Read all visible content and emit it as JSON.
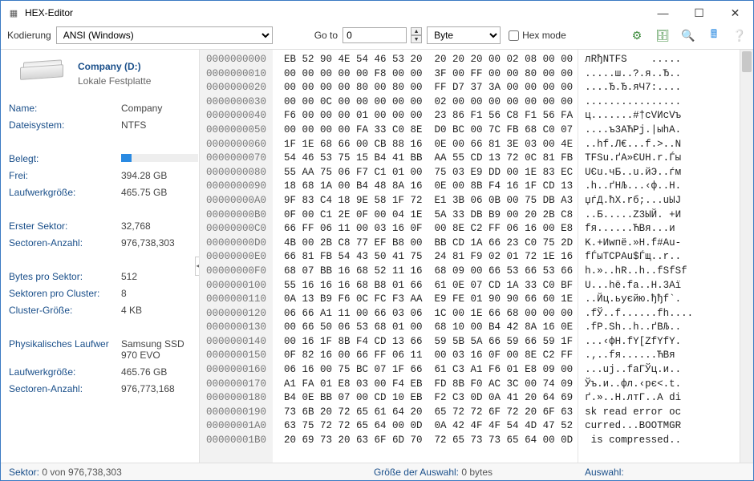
{
  "window": {
    "title": "HEX-Editor"
  },
  "toolbar": {
    "encoding_label": "Kodierung",
    "encoding_value": "ANSI (Windows)",
    "goto_label": "Go to",
    "goto_value": "0",
    "unit_value": "Byte",
    "hexmode_label": "Hex mode",
    "icons": [
      "gear-icon",
      "db-plus-icon",
      "search-icon",
      "calc-icon",
      "help-icon"
    ]
  },
  "drive": {
    "title": "Company (D:)",
    "subtitle": "Lokale Festplatte"
  },
  "props": [
    {
      "label": "Name:",
      "value": "Company"
    },
    {
      "label": "Dateisystem:",
      "value": "NTFS"
    },
    {
      "sep": true
    },
    {
      "label": "Belegt:",
      "value": "",
      "bar": 14
    },
    {
      "label": "Frei:",
      "value": "394.28 GB"
    },
    {
      "label": "Laufwerkgröße:",
      "value": "465.75 GB"
    },
    {
      "sep": true
    },
    {
      "label": "Erster Sektor:",
      "value": "32,768"
    },
    {
      "label": "Sectoren-Anzahl:",
      "value": "976,738,303"
    },
    {
      "sep": true
    },
    {
      "label": "Bytes pro Sektor:",
      "value": "512"
    },
    {
      "label": "Sektoren pro Cluster:",
      "value": "8"
    },
    {
      "label": "Cluster-Größe:",
      "value": "4 KB"
    },
    {
      "sep": true
    },
    {
      "label": "Physikalisches Laufwer",
      "value": "Samsung SSD 970 EVO"
    },
    {
      "label": "Laufwerkgröße:",
      "value": "465.76 GB"
    },
    {
      "label": "Sectoren-Anzahl:",
      "value": "976,773,168"
    }
  ],
  "hex": {
    "offsets": "0000000000\n0000000010\n0000000020\n0000000030\n0000000040\n0000000050\n0000000060\n0000000070\n0000000080\n0000000090\n00000000A0\n00000000B0\n00000000C0\n00000000D0\n00000000E0\n00000000F0\n0000000100\n0000000110\n0000000120\n0000000130\n0000000140\n0000000150\n0000000160\n0000000170\n0000000180\n0000000190\n00000001A0\n00000001B0",
    "bytes": "EB 52 90 4E 54 46 53 20  20 20 20 00 02 08 00 00\n00 00 00 00 00 F8 00 00  3F 00 FF 00 00 80 00 00\n00 00 00 00 80 00 80 00  FF D7 37 3A 00 00 00 00\n00 00 0C 00 00 00 00 00  02 00 00 00 00 00 00 00\nF6 00 00 00 01 00 00 00  23 86 F1 56 C8 F1 56 FA\n00 00 00 00 FA 33 C0 8E  D0 BC 00 7C FB 68 C0 07\n1F 1E 68 66 00 CB 88 16  0E 00 66 81 3E 03 00 4E\n54 46 53 75 15 B4 41 BB  AA 55 CD 13 72 0C 81 FB\n55 AA 75 06 F7 C1 01 00  75 03 E9 DD 00 1E 83 EC\n18 68 1A 00 B4 48 8A 16  0E 00 8B F4 16 1F CD 13\n9F 83 C4 18 9E 58 1F 72  E1 3B 06 0B 00 75 DB A3\n0F 00 C1 2E 0F 00 04 1E  5A 33 DB B9 00 20 2B C8\n66 FF 06 11 00 03 16 0F  00 8E C2 FF 06 16 00 E8\n4B 00 2B C8 77 EF B8 00  BB CD 1A 66 23 C0 75 2D\n66 81 FB 54 43 50 41 75  24 81 F9 02 01 72 1E 16\n68 07 BB 16 68 52 11 16  68 09 00 66 53 66 53 66\n55 16 16 16 68 B8 01 66  61 0E 07 CD 1A 33 C0 BF\n0A 13 B9 F6 0C FC F3 AA  E9 FE 01 90 90 66 60 1E\n06 66 A1 11 00 66 03 06  1C 00 1E 66 68 00 00 00\n00 66 50 06 53 68 01 00  68 10 00 B4 42 8A 16 0E\n00 16 1F 8B F4 CD 13 66  59 5B 5A 66 59 66 59 1F\n0F 82 16 00 66 FF 06 11  00 03 16 0F 00 8E C2 FF\n06 16 00 75 BC 07 1F 66  61 C3 A1 F6 01 E8 09 00\nA1 FA 01 E8 03 00 F4 EB  FD 8B F0 AC 3C 00 74 09\nB4 0E BB 07 00 CD 10 EB  F2 C3 0D 0A 41 20 64 69\n73 6B 20 72 65 61 64 20  65 72 72 6F 72 20 6F 63\n63 75 72 72 65 64 00 0D  0A 42 4F 4F 54 4D 47 52\n20 69 73 20 63 6F 6D 70  72 65 73 73 65 64 00 0D",
    "ascii": "лRђNTFS    .....\n.....ш..?.я..Ђ..\n....Ђ.Ђ.яЧ7:....\n................\nц.......#†сVИсVъ\n....ъ3АЋРј.|ыhА.\n..hf.Л€...f.>..N\nTFSu.ґA»ЄUН.r.Ѓы\nUЄu.чБ..u.йЭ..ѓм\n.h..ґHЉ...‹ф..Н.\nџѓД.ћX.rб;...uЫЈ\n..Б.....Z3ЫЙ. +И\nfя......ЋВя...и\nK.+Иwпё.»Н.f#Аu-\nfЃыTCPAu$Ѓщ..r..\nh.»..hR..h..fSfSf\nU...hё.fa..Н.3Аї\n..Йц.ьуєйю.ђђf`.\n.fЎ..f......fh....\n.fP.Sh..h..ґBЉ..\n...‹фН.fY[ZfYfY.\n.‚..fя......ЋВя\n...uј..fаГЎц.и..\nЎъ.и..фл.‹рє<.t.\nґ.»..Н.лтГ..A di\nsk read error oc\ncurred...BOOTMGR\n is compressed.."
  },
  "status": {
    "sector_label": "Sektor:",
    "sector_value": "0 von 976,738,303",
    "sel_label": "Größe der Auswahl:",
    "sel_value": "0 bytes",
    "selection_label": "Auswahl:"
  }
}
